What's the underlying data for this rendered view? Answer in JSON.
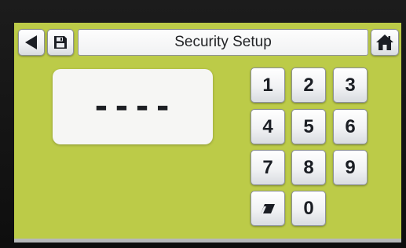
{
  "header": {
    "title": "Security Setup",
    "back_icon": "back-arrow-icon",
    "save_icon": "save-disk-icon",
    "home_icon": "home-icon"
  },
  "display": {
    "pin_value": "----"
  },
  "keypad": {
    "keys": [
      "1",
      "2",
      "3",
      "4",
      "5",
      "6",
      "7",
      "8",
      "9",
      "0"
    ],
    "clear_icon": "eraser-icon"
  },
  "colors": {
    "screen_background": "#bccb48",
    "button_face": "#f1f2f4",
    "display_background": "#f6f6f4",
    "text": "#1b1e24"
  }
}
